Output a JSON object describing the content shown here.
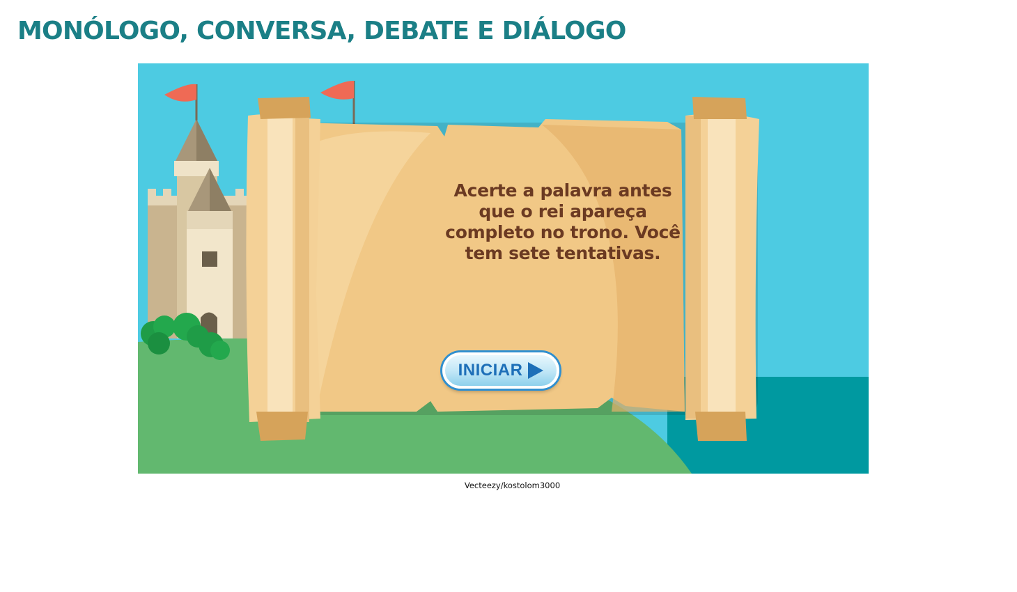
{
  "page": {
    "title": "MONÓLOGO, CONVERSA, DEBATE E DIÁLOGO"
  },
  "game": {
    "instructions": "Acerte a palavra antes que o rei apareça completo no trono. Você tem sete tentativas.",
    "start_button_label": "INICIAR",
    "start_button_icon": "play-arrow-icon"
  },
  "credit": "Vecteezy/kostolom3000",
  "colors": {
    "title": "#1b7f86",
    "sky": "#4dcbe2",
    "grass": "#62b86f",
    "sea": "#0099a0",
    "parchment": "#f1c886",
    "text": "#6b3a22",
    "button": "#1d6fb8"
  }
}
